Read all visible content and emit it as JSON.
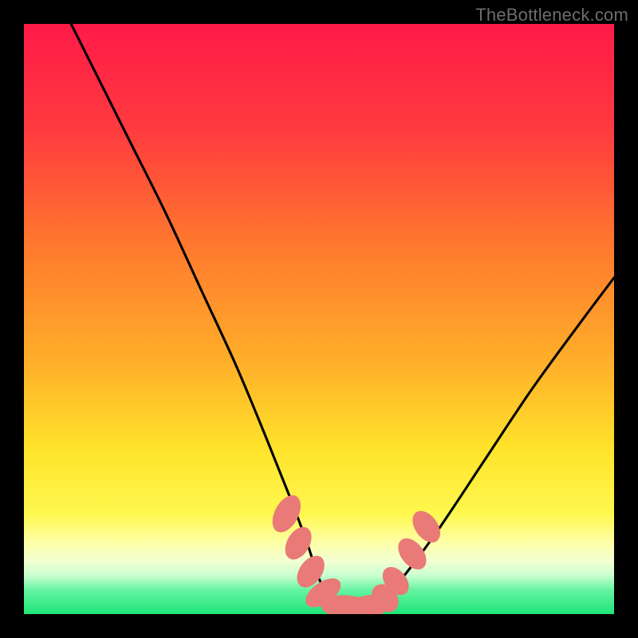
{
  "attribution": "TheBottleneck.com",
  "gradient": {
    "stops": [
      {
        "pct": 0,
        "color": "#ff1a48"
      },
      {
        "pct": 18,
        "color": "#ff3b3f"
      },
      {
        "pct": 38,
        "color": "#ff7a2d"
      },
      {
        "pct": 58,
        "color": "#ffb12a"
      },
      {
        "pct": 72,
        "color": "#ffe32a"
      },
      {
        "pct": 83,
        "color": "#fff84f"
      },
      {
        "pct": 88,
        "color": "#fdffa8"
      },
      {
        "pct": 91,
        "color": "#f3ffd2"
      },
      {
        "pct": 93.5,
        "color": "#c8ffd0"
      },
      {
        "pct": 96,
        "color": "#63f3a0"
      },
      {
        "pct": 100,
        "color": "#1fe578"
      }
    ]
  },
  "chart_data": {
    "type": "line",
    "title": "",
    "xlabel": "",
    "ylabel": "",
    "xlim": [
      0,
      100
    ],
    "ylim": [
      0,
      100
    ],
    "series": [
      {
        "name": "curve",
        "x": [
          8,
          12,
          18,
          24,
          30,
          36,
          41,
          45,
          48,
          50,
          52,
          55,
          58,
          60,
          64,
          70,
          78,
          86,
          94,
          100
        ],
        "y": [
          100,
          92,
          80,
          68,
          55,
          42,
          30,
          20,
          12,
          6,
          3,
          1,
          1,
          2,
          6,
          14,
          26,
          38,
          49,
          57
        ]
      }
    ],
    "markers": {
      "name": "highlight-points",
      "color": "#e97a77",
      "points": [
        {
          "x": 44.5,
          "y": 17,
          "rx": 2.0,
          "ry": 3.4,
          "rot": 28
        },
        {
          "x": 46.5,
          "y": 12,
          "rx": 1.9,
          "ry": 3.0,
          "rot": 30
        },
        {
          "x": 48.6,
          "y": 7.2,
          "rx": 1.9,
          "ry": 3.0,
          "rot": 35
        },
        {
          "x": 50.7,
          "y": 3.6,
          "rx": 1.8,
          "ry": 3.4,
          "rot": 55
        },
        {
          "x": 54.5,
          "y": 1.3,
          "rx": 4.2,
          "ry": 1.9,
          "rot": 3
        },
        {
          "x": 58.4,
          "y": 1.3,
          "rx": 3.4,
          "ry": 1.9,
          "rot": -6
        },
        {
          "x": 61.2,
          "y": 2.7,
          "rx": 2.0,
          "ry": 2.6,
          "rot": -40
        },
        {
          "x": 63.0,
          "y": 5.6,
          "rx": 1.8,
          "ry": 2.7,
          "rot": -40
        },
        {
          "x": 65.8,
          "y": 10.2,
          "rx": 1.9,
          "ry": 3.0,
          "rot": -38
        },
        {
          "x": 68.2,
          "y": 14.8,
          "rx": 1.9,
          "ry": 3.0,
          "rot": -36
        }
      ]
    }
  }
}
